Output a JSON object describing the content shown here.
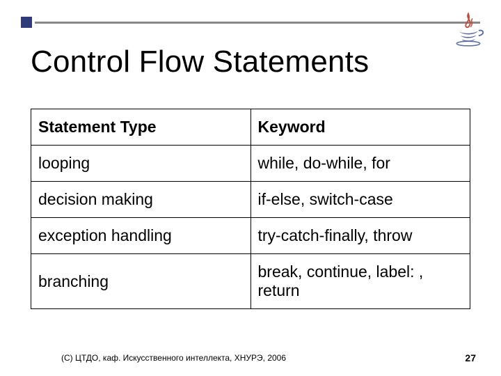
{
  "title": "Control Flow Statements",
  "table": {
    "header": {
      "col1": "Statement Type",
      "col2": "Keyword"
    },
    "rows": [
      {
        "c1": "looping",
        "c2": "while, do-while, for"
      },
      {
        "c1": "decision making",
        "c2": "if-else, switch-case"
      },
      {
        "c1": "exception handling",
        "c2": "try-catch-finally, throw"
      },
      {
        "c1": "branching",
        "c2": "break, continue, label: , return"
      }
    ]
  },
  "footer": {
    "copyright": "(С) ЦТДО, каф. Искусственного интеллекта, ХНУРЭ, 2006",
    "page": "27"
  },
  "logo": {
    "name": "java-logo"
  }
}
